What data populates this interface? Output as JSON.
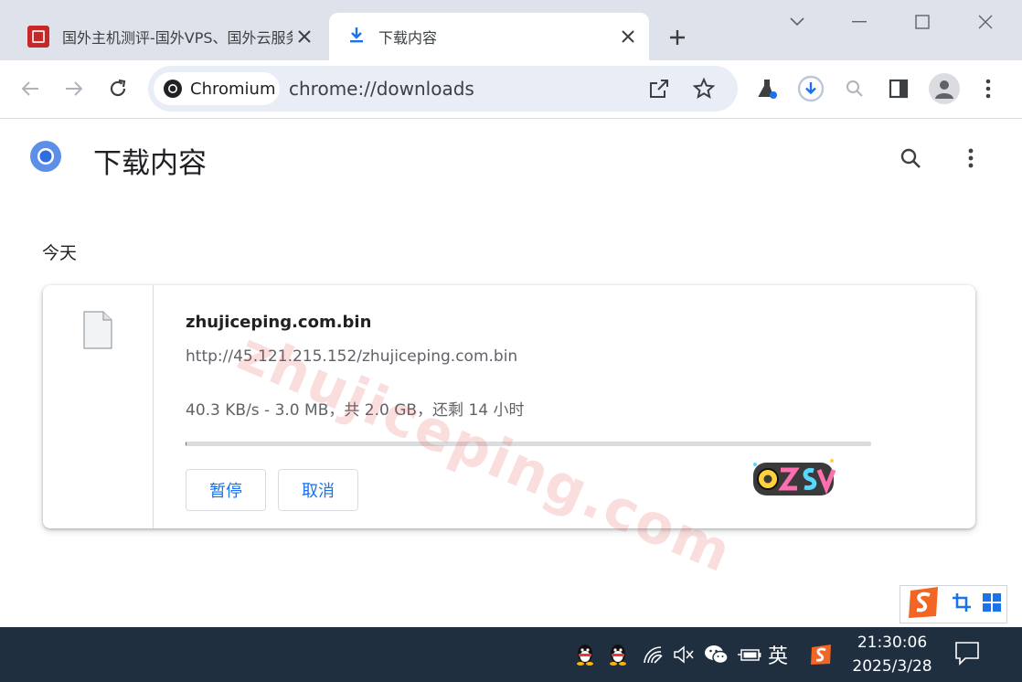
{
  "tabs": [
    {
      "title": "国外主机测评-国外VPS、国外云服务器",
      "active": false
    },
    {
      "title": "下载内容",
      "active": true
    }
  ],
  "toolbar": {
    "chip_label": "Chromium",
    "url": "chrome://downloads"
  },
  "page": {
    "title": "下载内容",
    "section_date": "今天"
  },
  "download": {
    "filename": "zhujiceping.com.bin",
    "source_url": "http://45.121.215.152/zhujiceping.com.bin",
    "status": "40.3 KB/s - 3.0 MB，共 2.0 GB，还剩 14 小时",
    "progress_fraction": 0.0015,
    "pause_label": "暂停",
    "cancel_label": "取消"
  },
  "watermark": "zhujiceping.com",
  "taskbar": {
    "ime_label": "英",
    "time": "21:30:06",
    "date": "2025/3/28"
  },
  "colors": {
    "accent": "#1a73e8",
    "tabstrip": "#dee3eb",
    "taskbar": "#1f2f40"
  }
}
